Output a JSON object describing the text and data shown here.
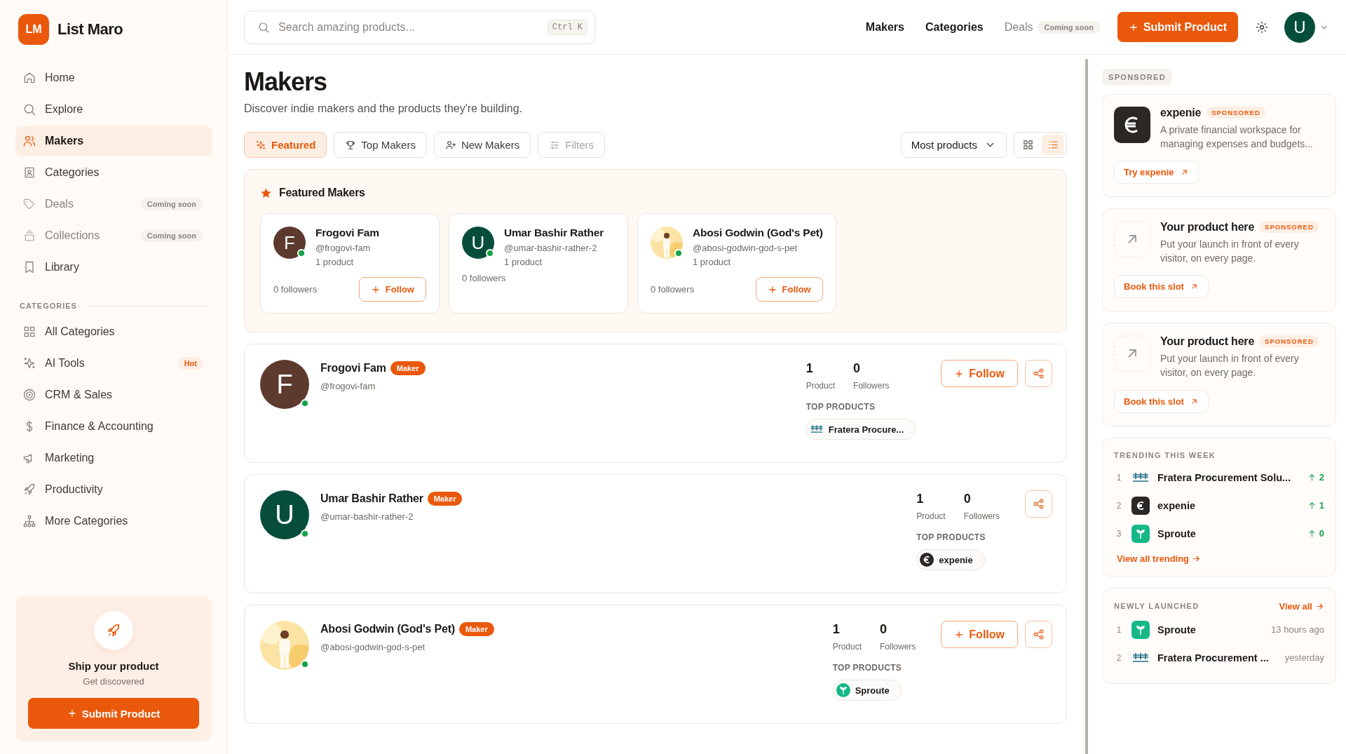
{
  "brand": {
    "initials": "LM",
    "name": "List Maro"
  },
  "nav": [
    {
      "label": "Home",
      "selected": false,
      "disabled": false
    },
    {
      "label": "Explore",
      "selected": false,
      "disabled": false
    },
    {
      "label": "Makers",
      "selected": true,
      "disabled": false
    },
    {
      "label": "Categories",
      "selected": false,
      "disabled": false
    },
    {
      "label": "Deals",
      "selected": false,
      "disabled": true,
      "badge": "Coming soon"
    },
    {
      "label": "Collections",
      "selected": false,
      "disabled": true,
      "badge": "Coming soon"
    },
    {
      "label": "Library",
      "selected": false,
      "disabled": false
    }
  ],
  "categories_heading": "CATEGORIES",
  "categories": [
    {
      "label": "All Categories"
    },
    {
      "label": "AI Tools",
      "badge": "Hot"
    },
    {
      "label": "CRM & Sales"
    },
    {
      "label": "Finance & Accounting"
    },
    {
      "label": "Marketing"
    },
    {
      "label": "Productivity"
    },
    {
      "label": "More Categories"
    }
  ],
  "promo": {
    "title": "Ship your product",
    "subtitle": "Get discovered",
    "button": "Submit Product"
  },
  "topbar": {
    "search": {
      "placeholder": "Search amazing products...",
      "shortcut": "Ctrl K"
    },
    "links": [
      {
        "label": "Makers",
        "disabled": false
      },
      {
        "label": "Categories",
        "disabled": false
      },
      {
        "label": "Deals",
        "disabled": true,
        "badge": "Coming soon"
      }
    ],
    "submit": "Submit Product",
    "avatar": "U"
  },
  "page": {
    "title": "Makers",
    "subtitle": "Discover indie makers and the products they're building.",
    "tabs": [
      {
        "label": "Featured",
        "selected": true
      },
      {
        "label": "Top Makers",
        "selected": false
      },
      {
        "label": "New Makers",
        "selected": false
      }
    ],
    "filters": "Filters",
    "sort": "Most products",
    "view_modes": [
      {
        "selected": false
      },
      {
        "selected": true
      }
    ]
  },
  "featured": {
    "title": "Featured Makers",
    "makers": [
      {
        "avatar": "F",
        "color": "#5d3a2e",
        "online": true,
        "name": "Frogovi Fam",
        "handle": "@frogovi-fam",
        "products": "1 product",
        "followers": "0 followers",
        "follow": "Follow"
      },
      {
        "avatar": "U",
        "color": "#064e3b",
        "online": true,
        "name": "Umar Bashir Rather",
        "handle": "@umar-bashir-rather-2",
        "products": "1 product",
        "followers": "0 followers"
      },
      {
        "kind": "picture",
        "online": true,
        "name": "Abosi Godwin (God's Pet)",
        "handle": "@abosi-godwin-god-s-pet",
        "products": "1 product",
        "followers": "0 followers",
        "follow": "Follow"
      }
    ]
  },
  "makers": [
    {
      "avatar": "F",
      "color": "#5d3a2e",
      "online": true,
      "name": "Frogovi Fam",
      "badge": "Maker",
      "handle": "@frogovi-fam",
      "product_count": "1",
      "product_label": "Product",
      "follower_count": "0",
      "follower_label": "Followers",
      "follow": "Follow",
      "top_heading": "TOP PRODUCTS",
      "top_product": {
        "name": "Fratera Procure...",
        "kind": "fratera"
      }
    },
    {
      "avatar": "U",
      "color": "#064e3b",
      "online": true,
      "name": "Umar Bashir Rather",
      "badge": "Maker",
      "handle": "@umar-bashir-rather-2",
      "product_count": "1",
      "product_label": "Product",
      "follower_count": "0",
      "follower_label": "Followers",
      "top_heading": "TOP PRODUCTS",
      "top_product": {
        "name": "expenie",
        "kind": "expenie"
      }
    },
    {
      "kind": "picture",
      "online": true,
      "name": "Abosi Godwin (God's Pet)",
      "badge": "Maker",
      "handle": "@abosi-godwin-god-s-pet",
      "product_count": "1",
      "product_label": "Product",
      "follower_count": "0",
      "follower_label": "Followers",
      "follow": "Follow",
      "top_heading": "TOP PRODUCTS",
      "top_product": {
        "name": "Sproute",
        "kind": "sproute"
      }
    }
  ],
  "aside": {
    "sponsored_label": "SPONSORED",
    "ads": [
      {
        "kind": "expenie",
        "title": "expenie",
        "badge": "SPONSORED",
        "description": "A private financial workspace for managing expenses and budgets...",
        "cta": "Try expenie"
      },
      {
        "kind": "placeholder",
        "title": "Your product here",
        "badge": "SPONSORED",
        "description": "Put your launch in front of every visitor, on every page.",
        "cta": "Book this slot"
      },
      {
        "kind": "placeholder",
        "title": "Your product here",
        "badge": "SPONSORED",
        "description": "Put your launch in front of every visitor, on every page.",
        "cta": "Book this slot"
      }
    ],
    "trending": {
      "heading": "TRENDING THIS WEEK",
      "items": [
        {
          "rank": "1",
          "kind": "fratera",
          "name": "Fratera Procurement Solu...",
          "change": "2"
        },
        {
          "rank": "2",
          "kind": "expenie",
          "name": "expenie",
          "change": "1"
        },
        {
          "rank": "3",
          "kind": "sproute",
          "name": "Sproute",
          "change": "0"
        }
      ],
      "link": "View all trending"
    },
    "newly": {
      "heading": "NEWLY LAUNCHED",
      "link": "View all",
      "items": [
        {
          "rank": "1",
          "kind": "sproute",
          "name": "Sproute",
          "time": "13 hours ago"
        },
        {
          "rank": "2",
          "kind": "fratera",
          "name": "Fratera Procurement ...",
          "time": "yesterday"
        }
      ]
    }
  }
}
